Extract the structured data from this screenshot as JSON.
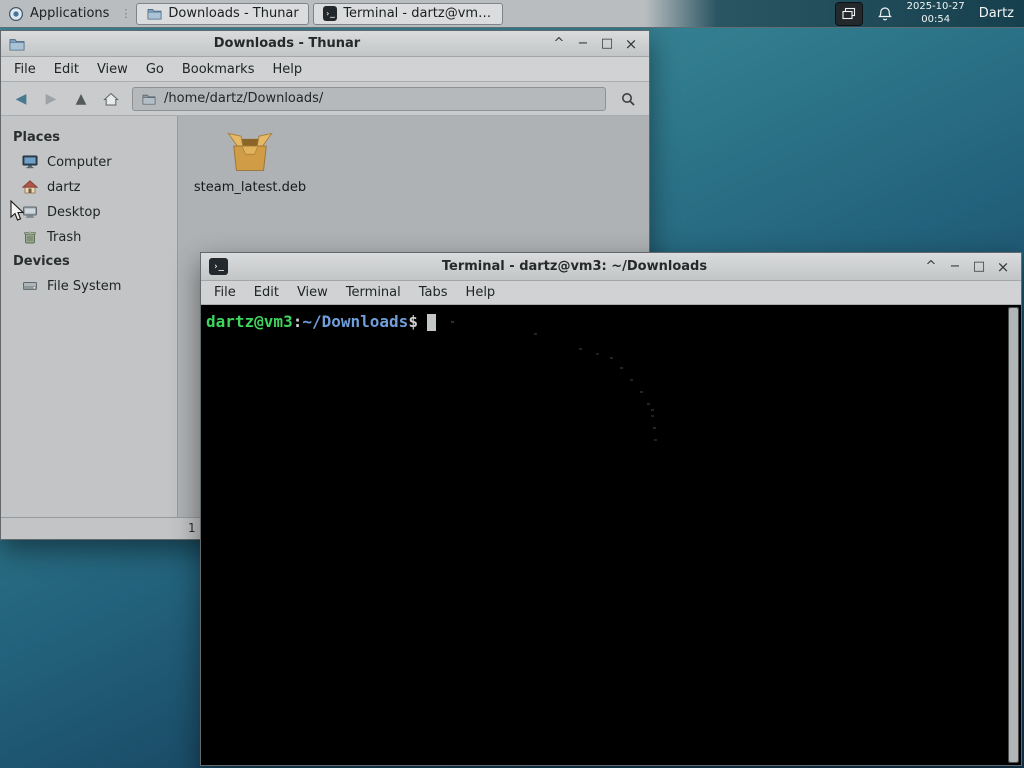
{
  "colors": {
    "desktop_teal": "#327d8f",
    "desktop_navy": "#133a57",
    "panel_dark": "#16404e",
    "window_chrome": "#c9cbcc",
    "fileview_bg": "#afb2b4",
    "terminal_bg": "#000000",
    "prompt_user_host": "#3fd45c",
    "prompt_path": "#6f9ed9",
    "prompt_symbol": "#cfd2d4",
    "package_icon_tan": "#d09c46"
  },
  "window_controls": {
    "shade": "^",
    "minimize": "−",
    "maximize": "□",
    "close": "×"
  },
  "panel": {
    "applications_label": "Applications",
    "window_buttons": [
      {
        "label": "Downloads - Thunar"
      },
      {
        "label": "Terminal - dartz@vm3: ..."
      }
    ],
    "clock_date": "2025-10-27",
    "clock_time": "00:54",
    "user_label": "Dartz"
  },
  "thunar": {
    "title": "Downloads - Thunar",
    "menu": [
      "File",
      "Edit",
      "View",
      "Go",
      "Bookmarks",
      "Help"
    ],
    "toolbar": {
      "path_value": "/home/dartz/Downloads/"
    },
    "sidebar": {
      "places_header": "Places",
      "places": [
        {
          "label": "Computer"
        },
        {
          "label": "dartz"
        },
        {
          "label": "Desktop"
        },
        {
          "label": "Trash"
        }
      ],
      "devices_header": "Devices",
      "devices": [
        {
          "label": "File System"
        }
      ]
    },
    "files": [
      {
        "name": "steam_latest.deb"
      }
    ],
    "statusbar_text": "1"
  },
  "terminal": {
    "title": "Terminal - dartz@vm3: ~/Downloads",
    "menu": [
      "File",
      "Edit",
      "View",
      "Terminal",
      "Tabs",
      "Help"
    ],
    "prompt": {
      "user_host": "dartz@vm3",
      "separator": ":",
      "path": "~/Downloads",
      "symbol": "$"
    }
  }
}
